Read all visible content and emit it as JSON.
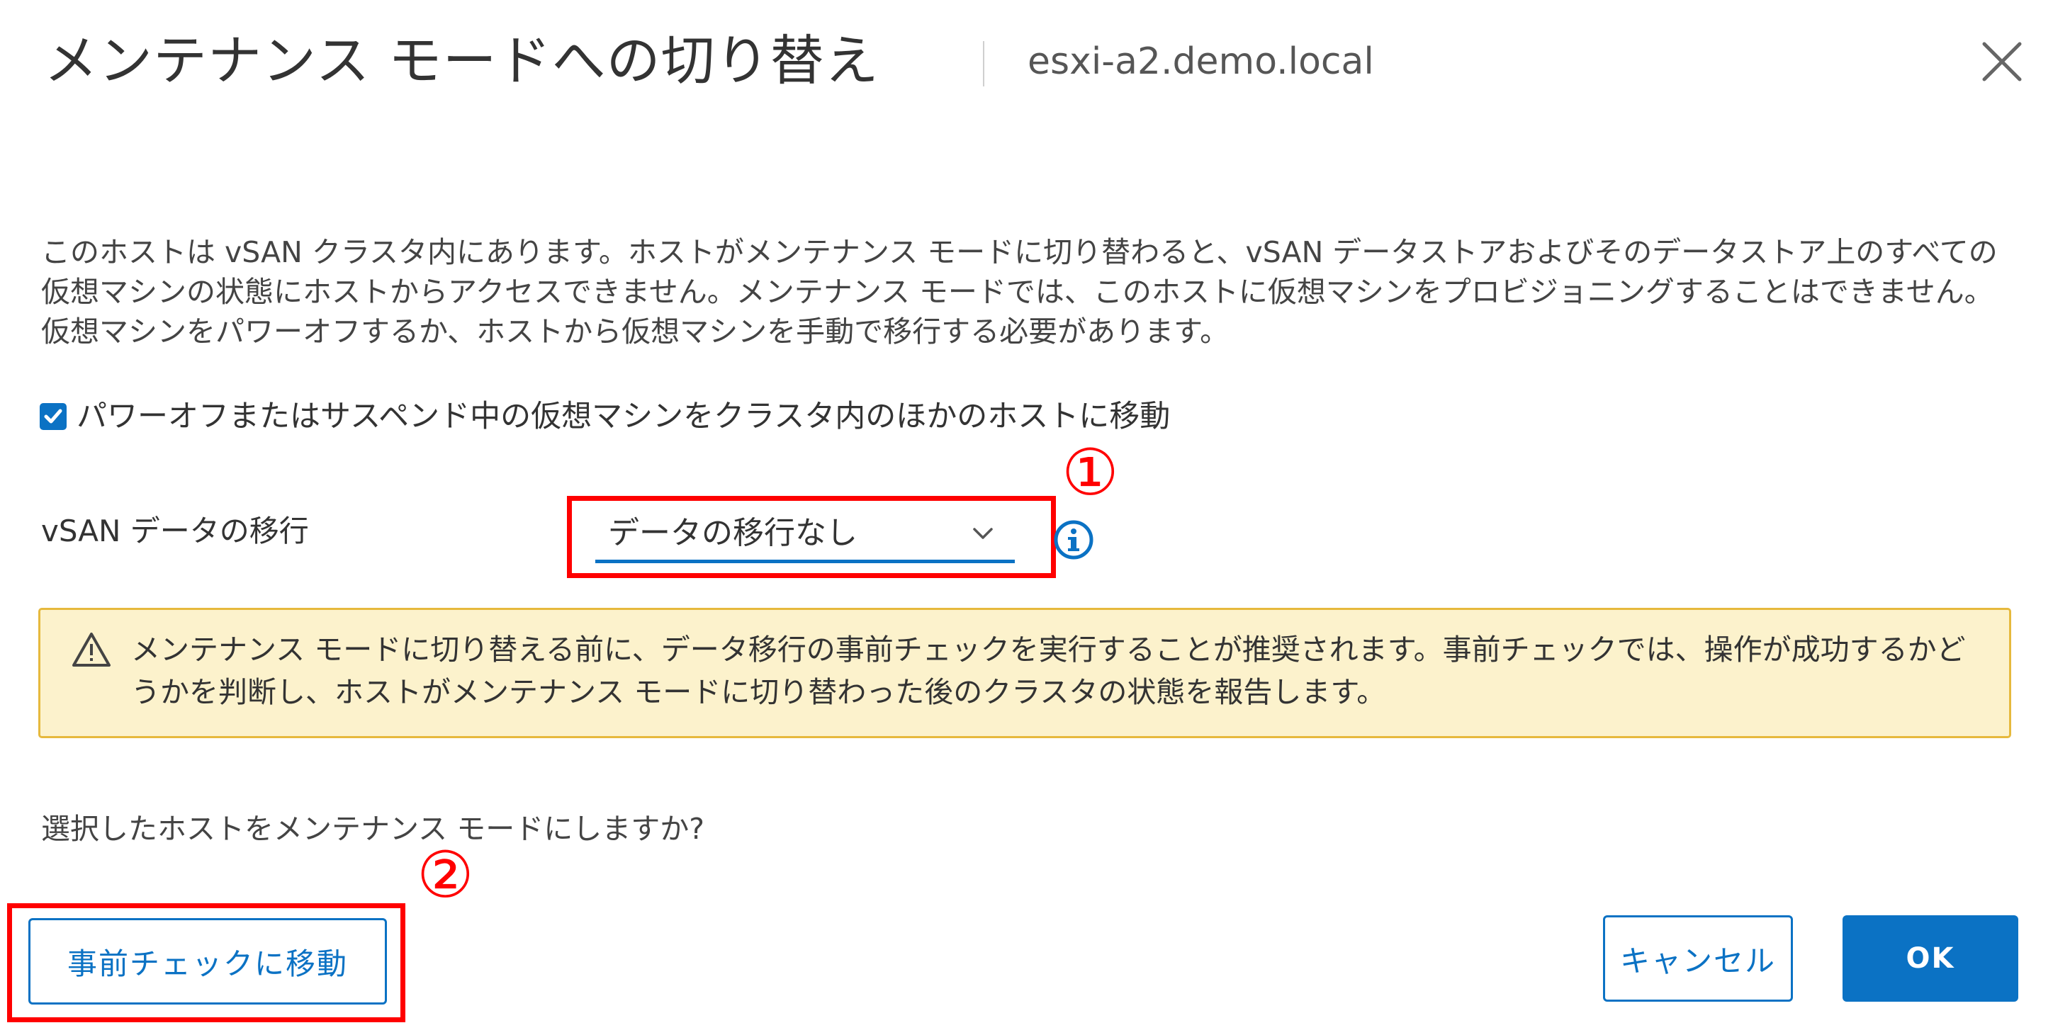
{
  "dialog": {
    "title": "メンテナンス モードへの切り替え",
    "hostname": "esxi-a2.demo.local",
    "description": "このホストは vSAN クラスタ内にあります。ホストがメンテナンス モードに切り替わると、vSAN データストアおよびそのデータストア上のすべての仮想マシンの状態にホストからアクセスできません。メンテナンス モードでは、このホストに仮想マシンをプロビジョニングすることはできません。仮想マシンをパワーオフするか、ホストから仮想マシンを手動で移行する必要があります。",
    "checkbox": {
      "label": "パワーオフまたはサスペンド中の仮想マシンをクラスタ内のほかのホストに移動",
      "checked": true
    },
    "vsan_migration": {
      "label": "vSAN データの移行",
      "selected": "データの移行なし"
    },
    "warning": {
      "text": "メンテナンス モードに切り替える前に、データ移行の事前チェックを実行することが推奨されます。事前チェックでは、操作が成功するかどうかを判断し、ホストがメンテナンス モードに切り替わった後のクラスタの状態を報告します。"
    },
    "question": "選択したホストをメンテナンス モードにしますか?",
    "buttons": {
      "precheck": "事前チェックに移動",
      "cancel": "キャンセル",
      "ok": "OK"
    }
  },
  "annotations": {
    "marker1": "①",
    "marker2": "②"
  },
  "colors": {
    "accent": "#0b72c4",
    "highlight": "#ff0000",
    "warning_bg": "#fcf2cc",
    "warning_border": "#e6b93d"
  }
}
